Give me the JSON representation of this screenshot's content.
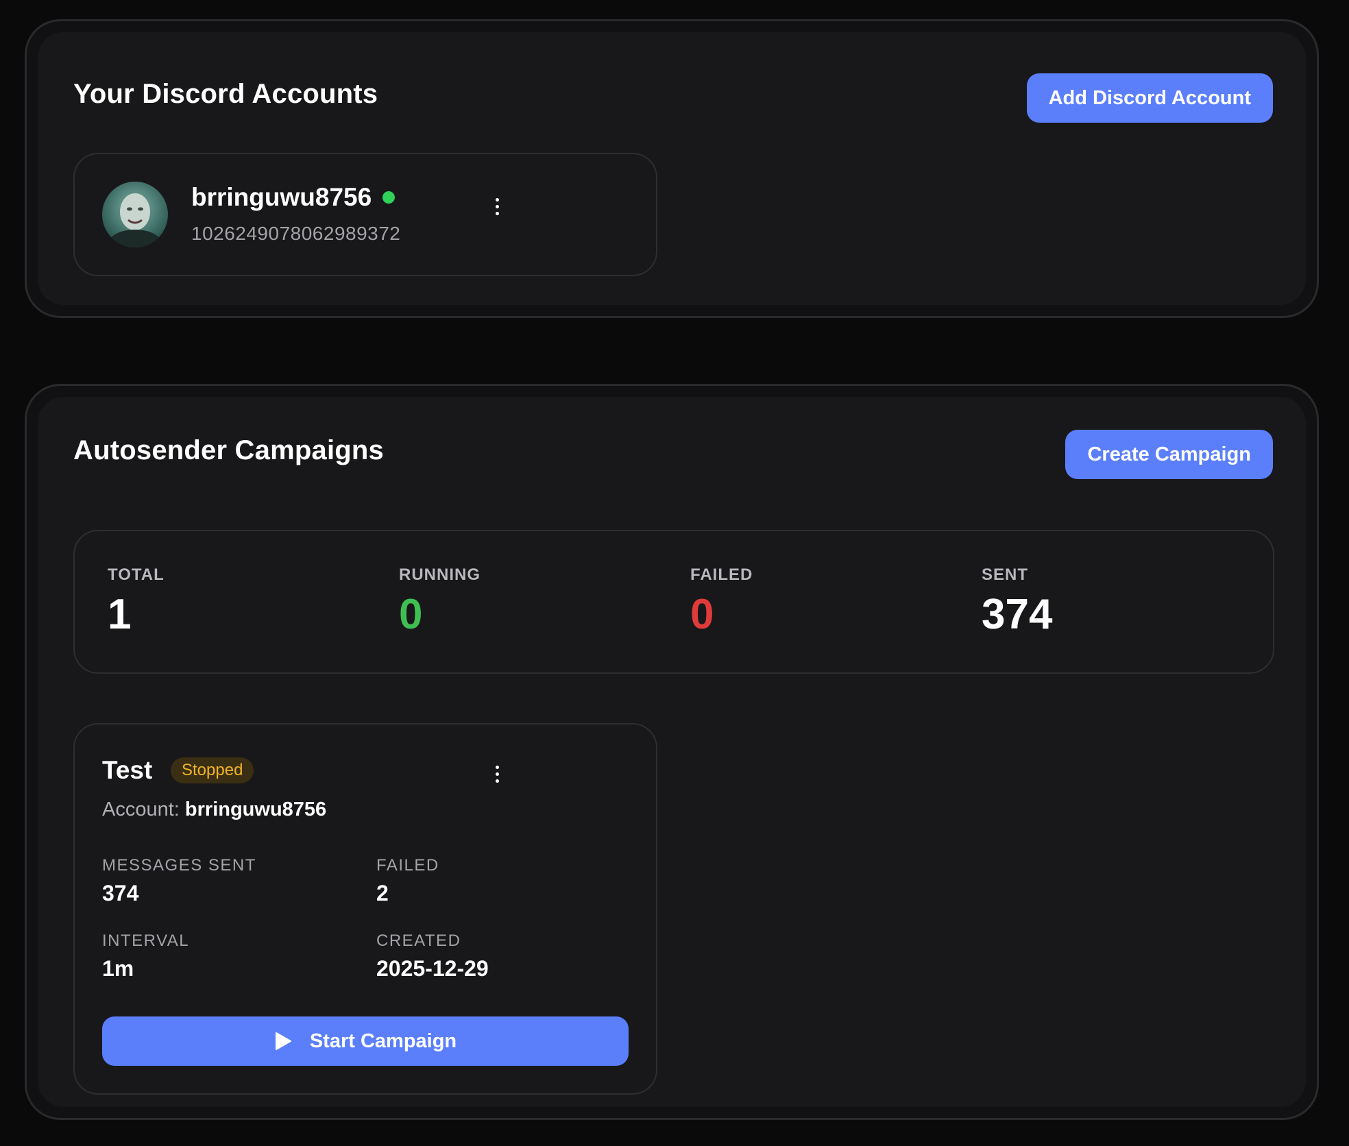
{
  "accounts_section": {
    "title": "Your Discord Accounts",
    "add_button_label": "Add Discord Account",
    "accounts": [
      {
        "username": "brringuwu8756",
        "id": "1026249078062989372",
        "status": "online",
        "status_color": "#2fd158"
      }
    ]
  },
  "campaigns_section": {
    "title": "Autosender Campaigns",
    "create_button_label": "Create Campaign",
    "stats": {
      "total_label": "TOTAL",
      "total_value": "1",
      "running_label": "RUNNING",
      "running_value": "0",
      "running_color": "#3fbf52",
      "failed_label": "FAILED",
      "failed_value": "0",
      "failed_color": "#e03b3b",
      "sent_label": "SENT",
      "sent_value": "374"
    },
    "campaigns": [
      {
        "name": "Test",
        "status": "Stopped",
        "account_label": "Account:",
        "account_value": "brringuwu8756",
        "messages_sent_label": "MESSAGES SENT",
        "messages_sent_value": "374",
        "failed_label": "FAILED",
        "failed_value": "2",
        "interval_label": "INTERVAL",
        "interval_value": "1m",
        "created_label": "CREATED",
        "created_value": "2025-12-29",
        "start_button_label": "Start Campaign"
      }
    ]
  },
  "theme": {
    "accent": "#5b7ffb",
    "badge_stopped_text": "#f0b429",
    "badge_stopped_bg": "#3a2f12"
  }
}
